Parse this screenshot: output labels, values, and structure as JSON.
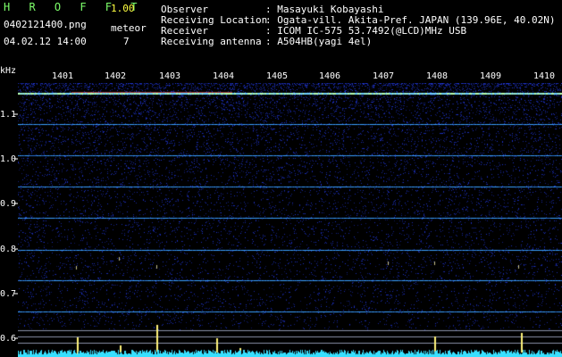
{
  "header": {
    "app_name": "H R O F F T",
    "version": "1.00",
    "filename": "0402121400.png",
    "datetime": "04.02.12 14:00",
    "meteor_label": "meteor",
    "meteor_count": "7"
  },
  "info": [
    {
      "label": "Observer",
      "value": ": Masayuki Kobayashi"
    },
    {
      "label": "Receiving Location",
      "value": ": Ogata-vill. Akita-Pref. JAPAN (139.96E, 40.02N)"
    },
    {
      "label": "Receiver",
      "value": ": ICOM IC-575 53.7492(@LCD)MHz USB"
    },
    {
      "label": "Receiving antenna",
      "value": ": A504HB(yagi 4el)"
    }
  ],
  "axes": {
    "y_unit": "kHz",
    "y_ticks": [
      "1.1",
      "1.0",
      "0.9",
      "0.8",
      "0.7",
      "0.6"
    ],
    "x_ticks": [
      "1401",
      "1402",
      "1403",
      "1404",
      "1405",
      "1406",
      "1407",
      "1408",
      "1409",
      "1410"
    ]
  },
  "colors": {
    "background": "#000000",
    "title": "#7dff6a",
    "version": "#ffff40",
    "noise": "#1a2ca8",
    "carrier": "#3aa0ff",
    "strong_carrier": "#b6ffb0"
  }
}
